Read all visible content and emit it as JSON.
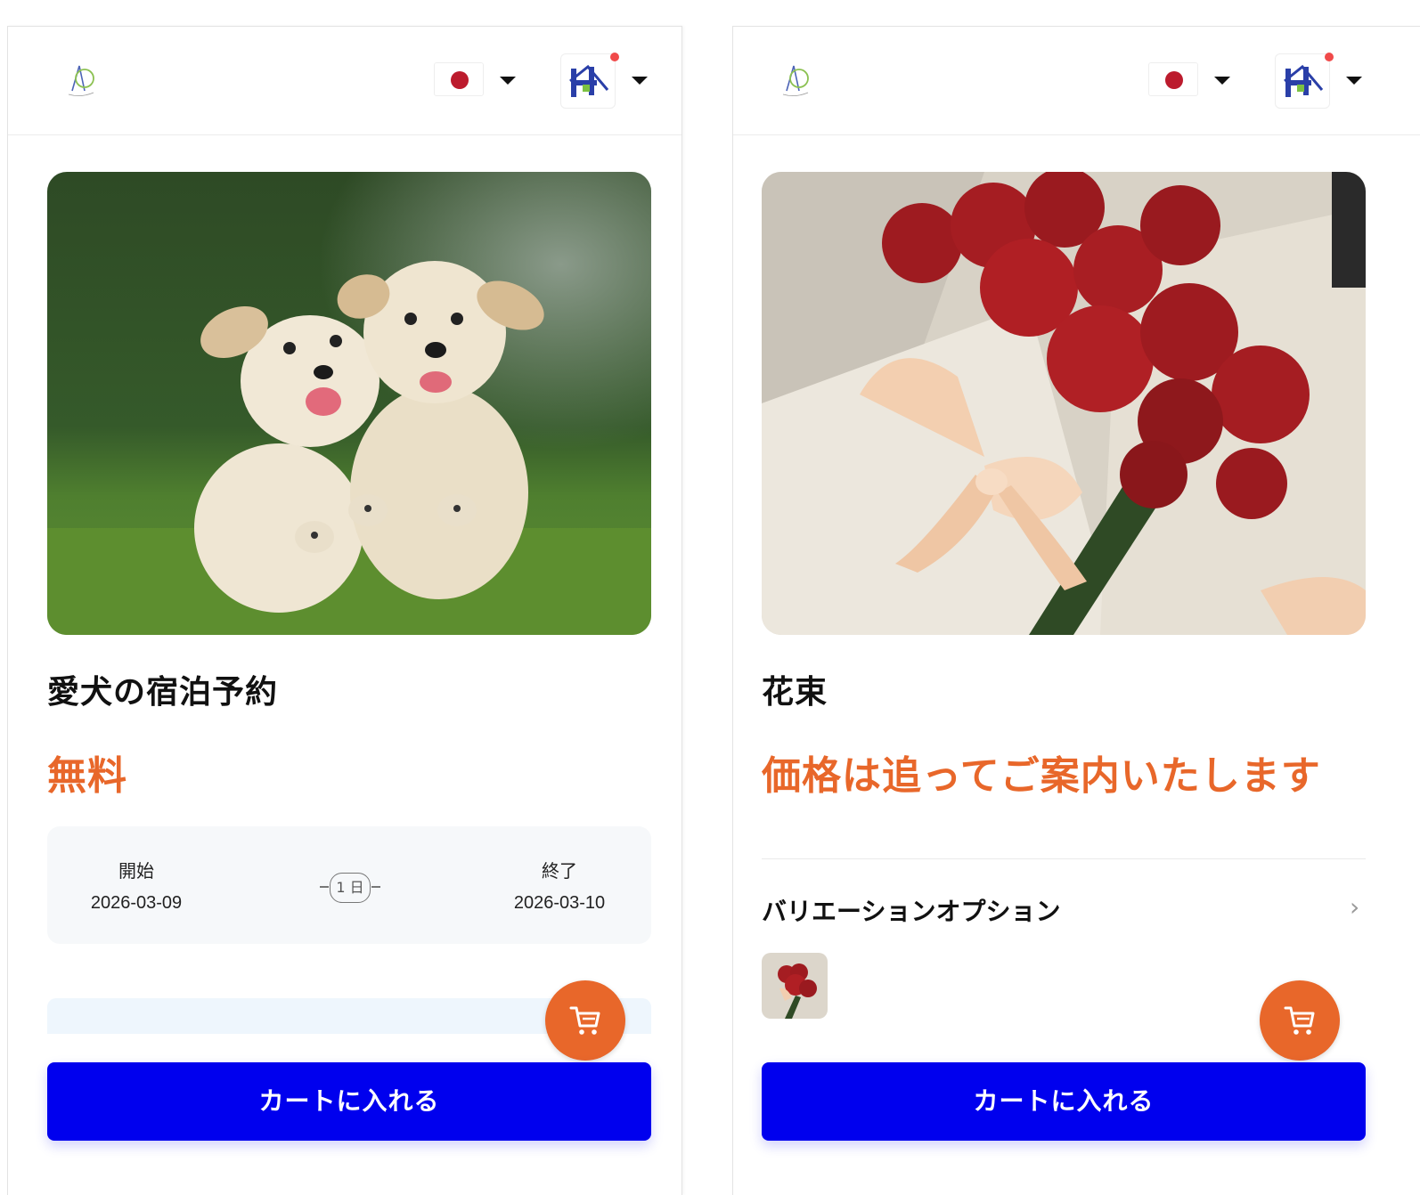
{
  "screens": [
    {
      "header": {
        "language_flag": "japan-flag",
        "account_icon": "hotel-logo-icon"
      },
      "product": {
        "image": "two-golden-retriever-puppies-running",
        "title": "愛犬の宿泊予約",
        "price": "無料"
      },
      "dates": {
        "start_label": "開始",
        "start_value": "2026-03-09",
        "duration": "1 日",
        "end_label": "終了",
        "end_value": "2026-03-10"
      },
      "cart_fab_icon": "cart-icon",
      "add_to_cart": "カートに入れる"
    },
    {
      "header": {
        "language_flag": "japan-flag",
        "account_icon": "hotel-logo-icon"
      },
      "product": {
        "image": "red-rose-bouquet-with-ribbon",
        "title": "花束",
        "price": "価格は追ってご案内いたします"
      },
      "variations": {
        "label": "バリエーションオプション",
        "chevron": "chevron-right-icon"
      },
      "cart_fab_icon": "cart-icon",
      "add_to_cart": "カートに入れる"
    }
  ],
  "colors": {
    "accent": "#e8672a",
    "primary": "#0000ee",
    "flag_red": "#bc1b2d"
  }
}
